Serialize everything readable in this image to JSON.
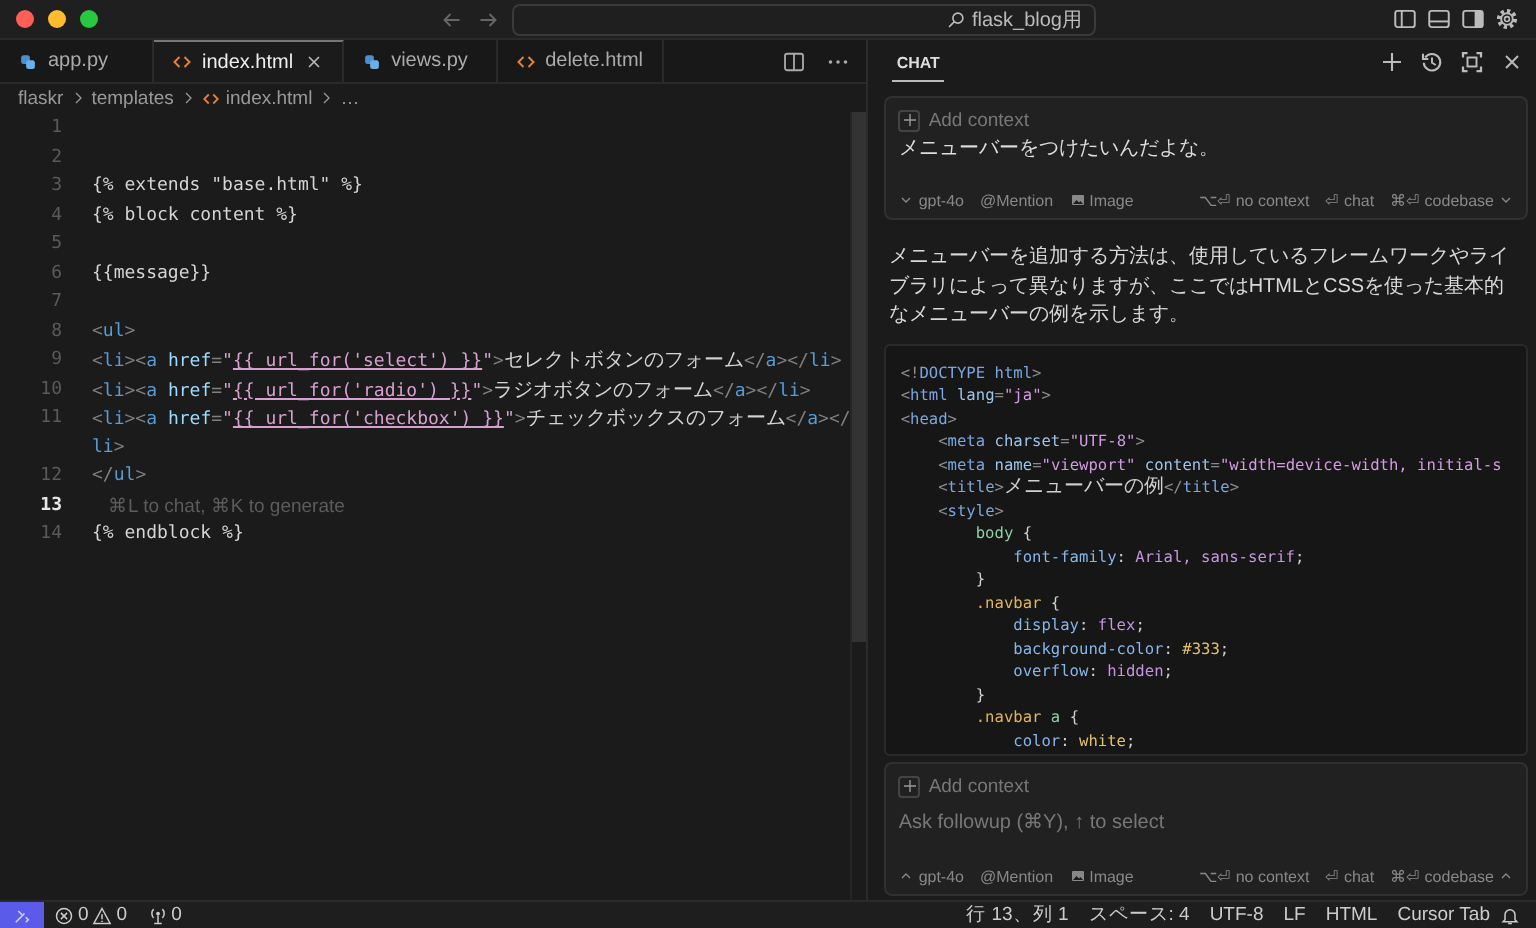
{
  "window": {
    "title": "flask_blog用"
  },
  "editor": {
    "tabs": [
      {
        "label": "app.py",
        "kind": "python",
        "selected": false
      },
      {
        "label": "index.html",
        "kind": "html",
        "selected": true
      },
      {
        "label": "views.py",
        "kind": "python",
        "selected": false
      },
      {
        "label": "delete.html",
        "kind": "html",
        "selected": false
      }
    ],
    "breadcrumb": [
      {
        "label": "flaskr",
        "kind": "folder"
      },
      {
        "label": "templates",
        "kind": "folder"
      },
      {
        "label": "index.html",
        "kind": "html"
      },
      {
        "label": "…",
        "kind": "more"
      }
    ],
    "lines": [
      {
        "number": "1",
        "current": false
      },
      {
        "number": "2",
        "current": false
      },
      {
        "number": "3",
        "current": false,
        "tokens": [
          {
            "kind": "tpl",
            "text": "{% extends \"base.html\" %}"
          }
        ]
      },
      {
        "number": "4",
        "current": false,
        "tokens": [
          {
            "kind": "tpl",
            "text": "{% block content %}"
          }
        ]
      },
      {
        "number": "5",
        "current": false
      },
      {
        "number": "6",
        "current": false,
        "tokens": [
          {
            "kind": "tpl",
            "text": "{{message}}"
          }
        ]
      },
      {
        "number": "7",
        "current": false
      },
      {
        "number": "8",
        "current": false,
        "tokens": [
          {
            "kind": "p",
            "text": "<"
          },
          {
            "kind": "tag",
            "text": "ul"
          },
          {
            "kind": "p",
            "text": ">"
          }
        ]
      },
      {
        "number": "9",
        "current": false,
        "tokens": [
          {
            "kind": "p",
            "text": "<"
          },
          {
            "kind": "tag",
            "text": "li"
          },
          {
            "kind": "p",
            "text": "><"
          },
          {
            "kind": "tag",
            "text": "a"
          },
          {
            "kind": "attr",
            "text": " href"
          },
          {
            "kind": "p",
            "text": "="
          },
          {
            "kind": "str",
            "text": "\""
          },
          {
            "kind": "expr",
            "text": "{{ url_for('select') }}"
          },
          {
            "kind": "str",
            "text": "\""
          },
          {
            "kind": "p",
            "text": ">"
          },
          {
            "kind": "text",
            "text": "セレクトボタンのフォーム"
          },
          {
            "kind": "p",
            "text": "</"
          },
          {
            "kind": "tag",
            "text": "a"
          },
          {
            "kind": "p",
            "text": "></"
          },
          {
            "kind": "tag",
            "text": "li"
          },
          {
            "kind": "p",
            "text": ">"
          }
        ]
      },
      {
        "number": "10",
        "current": false,
        "tokens": [
          {
            "kind": "p",
            "text": "<"
          },
          {
            "kind": "tag",
            "text": "li"
          },
          {
            "kind": "p",
            "text": "><"
          },
          {
            "kind": "tag",
            "text": "a"
          },
          {
            "kind": "attr",
            "text": " href"
          },
          {
            "kind": "p",
            "text": "="
          },
          {
            "kind": "str",
            "text": "\""
          },
          {
            "kind": "expr",
            "text": "{{ url_for('radio') }}"
          },
          {
            "kind": "str",
            "text": "\""
          },
          {
            "kind": "p",
            "text": ">"
          },
          {
            "kind": "text",
            "text": "ラジオボタンのフォーム"
          },
          {
            "kind": "p",
            "text": "</"
          },
          {
            "kind": "tag",
            "text": "a"
          },
          {
            "kind": "p",
            "text": "></"
          },
          {
            "kind": "tag",
            "text": "li"
          },
          {
            "kind": "p",
            "text": ">"
          }
        ]
      },
      {
        "number": "11",
        "current": false,
        "tokens": [
          {
            "kind": "p",
            "text": "<"
          },
          {
            "kind": "tag",
            "text": "li"
          },
          {
            "kind": "p",
            "text": "><"
          },
          {
            "kind": "tag",
            "text": "a"
          },
          {
            "kind": "attr",
            "text": " href"
          },
          {
            "kind": "p",
            "text": "="
          },
          {
            "kind": "str",
            "text": "\""
          },
          {
            "kind": "expr",
            "text": "{{ url_for('checkbox') }}"
          },
          {
            "kind": "str",
            "text": "\""
          },
          {
            "kind": "p",
            "text": ">"
          },
          {
            "kind": "text",
            "text": "チェックボックスのフォーム"
          },
          {
            "kind": "p",
            "text": "</"
          },
          {
            "kind": "tag",
            "text": "a"
          },
          {
            "kind": "p",
            "text": "></"
          }
        ]
      },
      {
        "tokens": [
          {
            "kind": "tag",
            "text": "li"
          },
          {
            "kind": "p",
            "text": ">"
          }
        ]
      },
      {
        "number": "12",
        "current": false,
        "tokens": [
          {
            "kind": "p",
            "text": "</"
          },
          {
            "kind": "tag",
            "text": "ul"
          },
          {
            "kind": "p",
            "text": ">"
          }
        ]
      },
      {
        "number": "13",
        "current": true,
        "hint": "⌘L to chat, ⌘K to generate"
      },
      {
        "number": "14",
        "current": false,
        "tokens": [
          {
            "kind": "tpl",
            "text": "{% endblock %}"
          }
        ]
      }
    ]
  },
  "chat": {
    "tabs": [
      {
        "label": "CHAT",
        "selected": true
      }
    ],
    "composer": {
      "add_context": "Add context",
      "message": "メニューバーをつけたいんだよな。",
      "footer_left": [
        {
          "kind": "model",
          "label": "gpt-4o",
          "caret_up": false
        },
        {
          "kind": "mention",
          "label": "@Mention"
        },
        {
          "kind": "image",
          "label": "Image"
        }
      ],
      "footer_right": [
        {
          "label": "⌥⏎ no context"
        },
        {
          "label": "⏎ chat"
        },
        {
          "label": "⌘⏎ codebase",
          "caret_up": false
        }
      ]
    },
    "response": {
      "paragraph": "メニューバーを追加する方法は、使用しているフレームワークやライブラリによって異なりますが、ここではHTMLとCSSを使った基本的なメニューバーの例を示します。",
      "code": [
        [
          {
            "kind": "p",
            "text": "<!"
          },
          {
            "kind": "tag",
            "text": "DOCTYPE"
          },
          {
            "kind": "tag",
            "text": " html"
          },
          {
            "kind": "p",
            "text": ">"
          }
        ],
        [
          {
            "kind": "p",
            "text": "<"
          },
          {
            "kind": "tag",
            "text": "html"
          },
          {
            "kind": "attr",
            "text": " lang"
          },
          {
            "kind": "p",
            "text": "="
          },
          {
            "kind": "str",
            "text": "\"ja\""
          },
          {
            "kind": "p",
            "text": ">"
          }
        ],
        [
          {
            "kind": "p",
            "text": "<"
          },
          {
            "kind": "tag",
            "text": "head"
          },
          {
            "kind": "p",
            "text": ">"
          }
        ],
        [
          {
            "kind": "p",
            "text": "    <"
          },
          {
            "kind": "tag",
            "text": "meta"
          },
          {
            "kind": "attr",
            "text": " charset"
          },
          {
            "kind": "p",
            "text": "="
          },
          {
            "kind": "str",
            "text": "\"UTF-8\""
          },
          {
            "kind": "p",
            "text": ">"
          }
        ],
        [
          {
            "kind": "p",
            "text": "    <"
          },
          {
            "kind": "tag",
            "text": "meta"
          },
          {
            "kind": "attr",
            "text": " name"
          },
          {
            "kind": "p",
            "text": "="
          },
          {
            "kind": "str",
            "text": "\"viewport\""
          },
          {
            "kind": "attr",
            "text": " content"
          },
          {
            "kind": "p",
            "text": "="
          },
          {
            "kind": "str",
            "text": "\"width=device-width, initial-s"
          }
        ],
        [
          {
            "kind": "p",
            "text": "    <"
          },
          {
            "kind": "tag",
            "text": "title"
          },
          {
            "kind": "p",
            "text": ">"
          },
          {
            "kind": "text",
            "text": "メニューバーの例"
          },
          {
            "kind": "p",
            "text": "</"
          },
          {
            "kind": "tag",
            "text": "title"
          },
          {
            "kind": "p",
            "text": ">"
          }
        ],
        [
          {
            "kind": "p",
            "text": "    <"
          },
          {
            "kind": "tag",
            "text": "style"
          },
          {
            "kind": "p",
            "text": ">"
          }
        ],
        [
          {
            "kind": "sel",
            "text": "        body"
          },
          {
            "kind": "t",
            "text": " {"
          }
        ],
        [
          {
            "kind": "prop",
            "text": "            font-family"
          },
          {
            "kind": "t",
            "text": ": "
          },
          {
            "kind": "val",
            "text": "Arial, sans-serif"
          },
          {
            "kind": "t",
            "text": ";"
          }
        ],
        [
          {
            "kind": "t",
            "text": "        }"
          }
        ],
        [
          {
            "kind": "cls",
            "text": "        .navbar"
          },
          {
            "kind": "t",
            "text": " {"
          }
        ],
        [
          {
            "kind": "prop",
            "text": "            display"
          },
          {
            "kind": "t",
            "text": ": "
          },
          {
            "kind": "val",
            "text": "flex"
          },
          {
            "kind": "t",
            "text": ";"
          }
        ],
        [
          {
            "kind": "prop",
            "text": "            background-color"
          },
          {
            "kind": "t",
            "text": ": "
          },
          {
            "kind": "num",
            "text": "#333"
          },
          {
            "kind": "t",
            "text": ";"
          }
        ],
        [
          {
            "kind": "prop",
            "text": "            overflow"
          },
          {
            "kind": "t",
            "text": ": "
          },
          {
            "kind": "val",
            "text": "hidden"
          },
          {
            "kind": "t",
            "text": ";"
          }
        ],
        [
          {
            "kind": "t",
            "text": "        }"
          }
        ],
        [
          {
            "kind": "cls",
            "text": "        .navbar"
          },
          {
            "kind": "sel",
            "text": " a"
          },
          {
            "kind": "t",
            "text": " {"
          }
        ],
        [
          {
            "kind": "prop",
            "text": "            color"
          },
          {
            "kind": "t",
            "text": ": "
          },
          {
            "kind": "num",
            "text": "white"
          },
          {
            "kind": "t",
            "text": ";"
          }
        ]
      ]
    },
    "followup": {
      "add_context": "Add context",
      "placeholder": "Ask followup (⌘Y), ↑ to select",
      "footer_left": [
        {
          "kind": "model",
          "label": "gpt-4o",
          "caret_up": true
        },
        {
          "kind": "mention",
          "label": "@Mention"
        },
        {
          "kind": "image",
          "label": "Image"
        }
      ],
      "footer_right": [
        {
          "label": "⌥⏎ no context"
        },
        {
          "label": "⏎ chat"
        },
        {
          "label": "⌘⏎ codebase",
          "caret_up": true
        }
      ]
    }
  },
  "status_bar": {
    "errors": "0",
    "warnings": "0",
    "ports": "0",
    "items": [
      "行 13、列 1",
      "スペース: 4",
      "UTF-8",
      "LF",
      "HTML",
      "Cursor Tab"
    ]
  }
}
